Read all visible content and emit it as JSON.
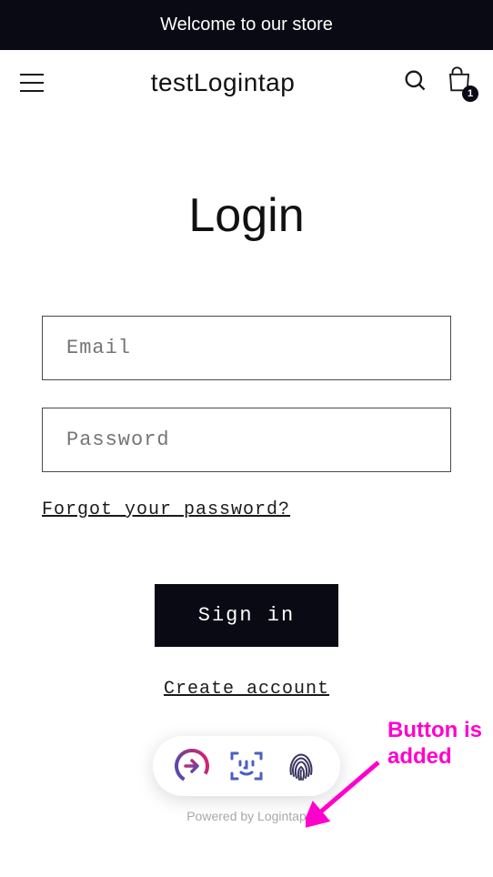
{
  "announcement": {
    "text": "Welcome to our store"
  },
  "header": {
    "storeName": "testLogintap",
    "cartCount": "1"
  },
  "login": {
    "title": "Login",
    "emailPlaceholder": "Email",
    "passwordPlaceholder": "Password",
    "forgotLink": "Forgot your password?",
    "signInLabel": "Sign in",
    "createAccountLabel": "Create account"
  },
  "logintap": {
    "poweredBy": "Powered by Logintap"
  },
  "annotation": {
    "text": "Button is added"
  }
}
